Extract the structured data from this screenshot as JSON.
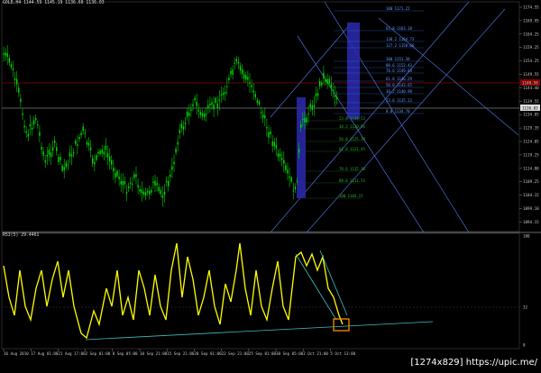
{
  "main": {
    "header": "GOLD,H4  1144.59 1145.19 1136.60 1136.03",
    "price_levels": [
      "1174.55",
      "1169.95",
      "1164.25",
      "1159.25",
      "1154.25",
      "1149.55",
      "1144.40",
      "1139.55",
      "1134.05",
      "1129.35",
      "1124.05",
      "1119.25",
      "1114.00",
      "1109.25",
      "1104.15",
      "1099.10",
      "1094.15"
    ],
    "current_price": "1136.03",
    "red_line_price": "1148.59",
    "fib_upper": [
      "100 1171.22",
      "61.8 1163.18",
      "138.2 1164.73",
      "127.2 1158.66",
      "100 1151.38",
      "88.6 1152.43",
      "78.6 1149.64",
      "61.8 1146.29",
      "50.0 1143.65",
      "38.2 1140.98",
      "23.6 1135.22",
      "0.0 1134.70"
    ],
    "fib_lower": [
      "23.6 1134.53",
      "38.2 1130.94",
      "50.0 1125.39",
      "61.8 1121.45",
      "78.6 1115.30",
      "88.6 1111.53",
      "100 1104.15"
    ]
  },
  "rsi": {
    "header": "RSI(5) 29.4461",
    "levels": [
      "100",
      "32",
      "0"
    ]
  },
  "time_labels": [
    "16 Aug 2010",
    "17 Aug 01:00",
    "21 Aug 17:00",
    "2 Sep 01:00",
    "8 Sep 05:00",
    "10 Sep 21:00",
    "15 Sep 21:00",
    "20 Sep 01:00",
    "22 Sep 21:00",
    "25 Sep 01:00",
    "30 Sep 05:00",
    "2 Oct 21:00",
    "5 Oct 13:00"
  ],
  "colors": {
    "bull": "#00e000",
    "fib": "#3f7fff",
    "rsi": "#ffff00",
    "accent_box": "#ff8c00",
    "price_box": "#8b0000"
  },
  "watermark": "[1274x829] https://upic.me/"
}
